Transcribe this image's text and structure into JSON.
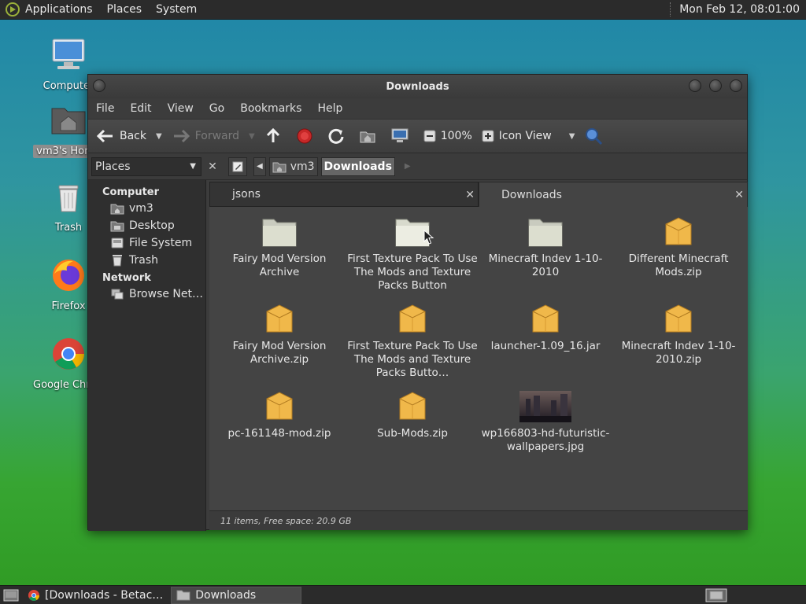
{
  "top_panel": {
    "menus": [
      "Applications",
      "Places",
      "System"
    ],
    "clock": "Mon Feb 12, 08:01:00"
  },
  "desktop": {
    "icons": [
      {
        "label": "Computer"
      },
      {
        "label": "vm3's Home"
      },
      {
        "label": "Trash"
      },
      {
        "label": "Firefox"
      },
      {
        "label": "Google Chrome"
      }
    ]
  },
  "window": {
    "title": "Downloads",
    "menubar": [
      "File",
      "Edit",
      "View",
      "Go",
      "Bookmarks",
      "Help"
    ],
    "toolbar": {
      "back": "Back",
      "forward": "Forward",
      "zoom": "100%",
      "view_mode": "Icon View"
    },
    "places_combo": "Places",
    "breadcrumbs": [
      "vm3",
      "Downloads"
    ],
    "sidebar": {
      "computer_header": "Computer",
      "computer_items": [
        "vm3",
        "Desktop",
        "File System",
        "Trash"
      ],
      "network_header": "Network",
      "network_items": [
        "Browse Net…"
      ]
    },
    "tabs": [
      {
        "label": "jsons"
      },
      {
        "label": "Downloads"
      }
    ],
    "files": [
      {
        "name": "Fairy Mod Version Archive",
        "type": "folder"
      },
      {
        "name": "First Texture Pack To Use The Mods and Texture Packs Button",
        "type": "folder"
      },
      {
        "name": "Minecraft Indev 1-10-2010",
        "type": "folder"
      },
      {
        "name": "Different Minecraft Mods.zip",
        "type": "archive"
      },
      {
        "name": "Fairy Mod Version Archive.zip",
        "type": "archive"
      },
      {
        "name": "First Texture Pack To Use The Mods and Texture Packs Butto…",
        "type": "archive"
      },
      {
        "name": "launcher-1.09_16.jar",
        "type": "archive"
      },
      {
        "name": "Minecraft Indev 1-10-2010.zip",
        "type": "archive"
      },
      {
        "name": "pc-161148-mod.zip",
        "type": "archive"
      },
      {
        "name": "Sub-Mods.zip",
        "type": "archive"
      },
      {
        "name": "wp166803-hd-futuristic-wallpapers.jpg",
        "type": "image"
      }
    ],
    "status": "11 items, Free space: 20.9 GB"
  },
  "taskbar": {
    "tasks": [
      "[Downloads - Betac…",
      "Downloads"
    ]
  }
}
